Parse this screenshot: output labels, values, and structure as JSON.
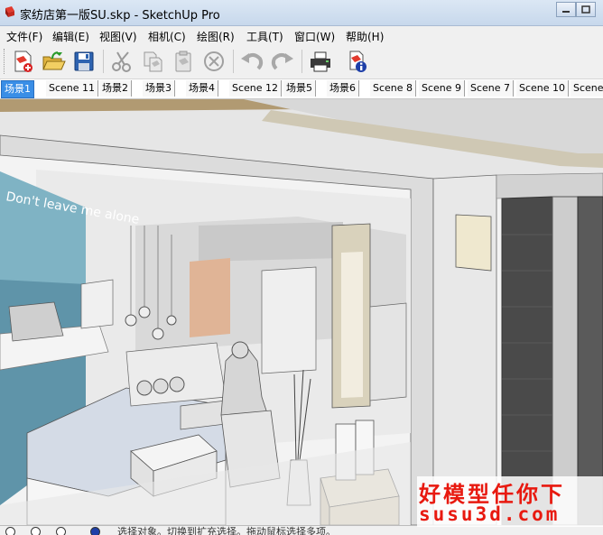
{
  "window": {
    "title": "家纺店第一版SU.skp - SketchUp Pro"
  },
  "menu": {
    "items": [
      "文件(F)",
      "编辑(E)",
      "视图(V)",
      "相机(C)",
      "绘图(R)",
      "工具(T)",
      "窗口(W)",
      "帮助(H)"
    ]
  },
  "toolbar": {
    "buttons": [
      "new-icon",
      "open-icon",
      "save-icon",
      "cut-icon",
      "copy-icon",
      "paste-icon",
      "erase-icon",
      "undo-icon",
      "redo-icon",
      "print-icon",
      "model-info-icon"
    ]
  },
  "scene_tabs": {
    "tabs": [
      "场景1",
      "Scene 11",
      "场景2",
      "场景3",
      "场景4",
      "Scene 12",
      "场景5",
      "场景6",
      "Scene 8",
      "Scene 9",
      "Scene 7",
      "Scene 10",
      "Scene"
    ],
    "active": "场景1"
  },
  "viewport": {
    "wall_text": "Don't leave me alone"
  },
  "status": {
    "text": "选择对象。切换到扩充选择。拖动鼠标选择多项。"
  },
  "watermark": {
    "line1": "好模型任你下",
    "line2": "susu3d.com",
    "color": "#e8190f"
  }
}
